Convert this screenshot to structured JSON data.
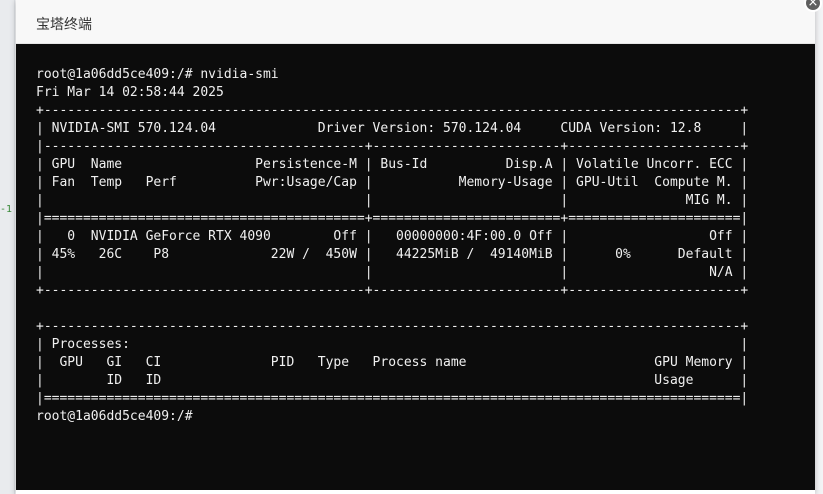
{
  "window": {
    "title": "宝塔终端",
    "close_glyph": "×"
  },
  "background": {
    "side_marker": "-1"
  },
  "terminal": {
    "lines": [
      "root@1a06dd5ce409:/# nvidia-smi",
      "Fri Mar 14 02:58:44 2025",
      "+-----------------------------------------------------------------------------------------+",
      "| NVIDIA-SMI 570.124.04             Driver Version: 570.124.04     CUDA Version: 12.8     |",
      "|-----------------------------------------+------------------------+----------------------+",
      "| GPU  Name                 Persistence-M | Bus-Id          Disp.A | Volatile Uncorr. ECC |",
      "| Fan  Temp   Perf          Pwr:Usage/Cap |           Memory-Usage | GPU-Util  Compute M. |",
      "|                                         |                        |               MIG M. |",
      "|=========================================+========================+======================|",
      "|   0  NVIDIA GeForce RTX 4090        Off |   00000000:4F:00.0 Off |                  Off |",
      "| 45%   26C    P8             22W /  450W |   44225MiB /  49140MiB |      0%      Default |",
      "|                                         |                        |                  N/A |",
      "+-----------------------------------------+------------------------+----------------------+",
      "",
      "+-----------------------------------------------------------------------------------------+",
      "| Processes:                                                                              |",
      "|  GPU   GI   CI              PID   Type   Process name                        GPU Memory |",
      "|        ID   ID                                                               Usage      |",
      "|=========================================================================================|",
      "root@1a06dd5ce409:/#"
    ]
  }
}
